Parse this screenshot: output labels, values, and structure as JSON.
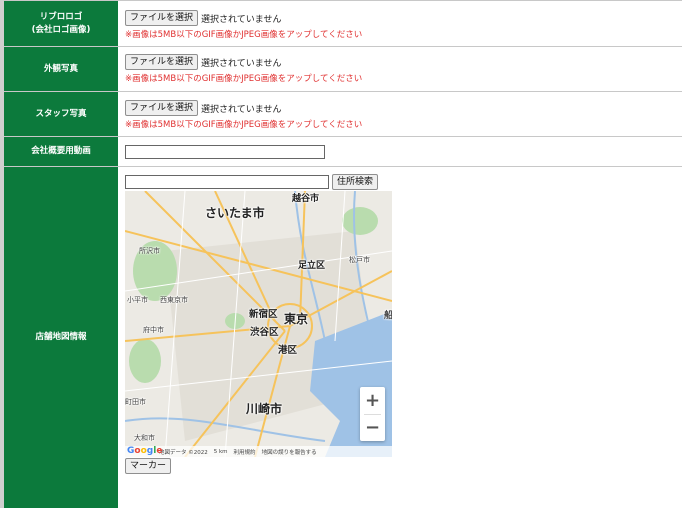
{
  "form": {
    "logo": {
      "label_line1": "リブロロゴ",
      "label_line2": "(会社ロゴ画像)",
      "button": "ファイルを選択",
      "status": "選択されていません",
      "note": "※画像は5MB以下のGIF画像かJPEG画像をアップしてください"
    },
    "exterior": {
      "label": "外観写真",
      "button": "ファイルを選択",
      "status": "選択されていません",
      "note": "※画像は5MB以下のGIF画像かJPEG画像をアップしてください"
    },
    "staff": {
      "label": "スタッフ写真",
      "button": "ファイルを選択",
      "status": "選択されていません",
      "note": "※画像は5MB以下のGIF画像かJPEG画像をアップしてください"
    },
    "video": {
      "label": "会社概要用動画",
      "value": ""
    },
    "map": {
      "label": "店舗地図情報",
      "address_value": "",
      "search_button": "住所検索",
      "marker_button": "マーカー",
      "zoom_in": "+",
      "zoom_out": "−",
      "footer_data": "地図データ ©2022",
      "footer_scale": "5 km",
      "footer_terms": "利用規約",
      "footer_report": "地図の誤りを報告する",
      "google_logo": "Google",
      "places": {
        "saitama": "さいたま市",
        "koshigaya": "越谷市",
        "adachi": "足立区",
        "shinjuku": "新宿区",
        "tokyo": "東京",
        "shibuya": "渋谷区",
        "minato": "港区",
        "kawasaki": "川崎市",
        "tokorozawa": "所沢市",
        "matsudo": "松戸市",
        "fuchu": "府中市",
        "machida": "町田市",
        "yamato": "大和市",
        "nishitokyo": "西東京市",
        "kodaira": "小平市",
        "funabashi": "船"
      },
      "colors": {
        "land": "#eceae4",
        "water": "#9fc2e6",
        "green": "#b9dcae",
        "road": "#f6c35b",
        "city": "#dedad2"
      }
    }
  }
}
